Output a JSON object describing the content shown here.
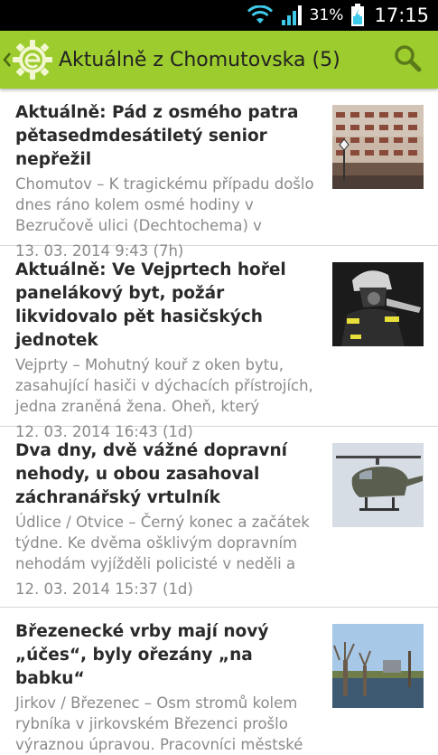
{
  "status_bar": {
    "battery_percent": "31%",
    "time": "17:15",
    "icons": [
      "wifi-icon",
      "signal-icon",
      "battery-charging-icon"
    ]
  },
  "app_bar": {
    "title": "Aktuálně z Chomutovska (5)",
    "icons": [
      "up-chevron-icon",
      "app-logo-icon",
      "search-icon"
    ],
    "accent_color": "#9dcc2e"
  },
  "articles": [
    {
      "title": "Aktuálně: Pád z osmého patra pětasedmdesátiletý senior nepřežil",
      "teaser": "Chomutov – K tragickému případu došlo dnes ráno kolem osmé hodiny v Bezručově ulici (Dechtochema) v",
      "meta": "13. 03. 2014 9:43 (7h)",
      "thumbnail": "apartment-building-photo"
    },
    {
      "title": "Aktuálně: Ve Vejprtech hořel panelákový byt, požár likvidovalo pět hasičských jednotek",
      "teaser": "Vejprty – Mohutný kouř z oken bytu, zasahující hasiči v dýchacích přístrojích, jedna zraněná žena. Oheň, který",
      "meta": "12. 03. 2014 16:43 (1d)",
      "thumbnail": "firefighter-photo"
    },
    {
      "title": "Dva dny, dvě vážné dopravní nehody, u obou zasahoval záchranářský vrtulník",
      "teaser": "Údlice / Otvice – Černý konec a začátek týdne. Ke dvěma ošklivým dopravním nehodám vyjížděli policisté v neděli a",
      "meta": "12. 03. 2014 15:37 (1d)",
      "thumbnail": "helicopter-photo"
    },
    {
      "title": "Březenecké vrby mají nový „účes“, byly ořezány „na babku“",
      "teaser": "Jirkov / Březenec – Osm stromů kolem rybníka v jirkovském Březenci prošlo výraznou úpravou. Pracovníci městské",
      "meta": "",
      "thumbnail": "pond-willows-photo"
    }
  ]
}
